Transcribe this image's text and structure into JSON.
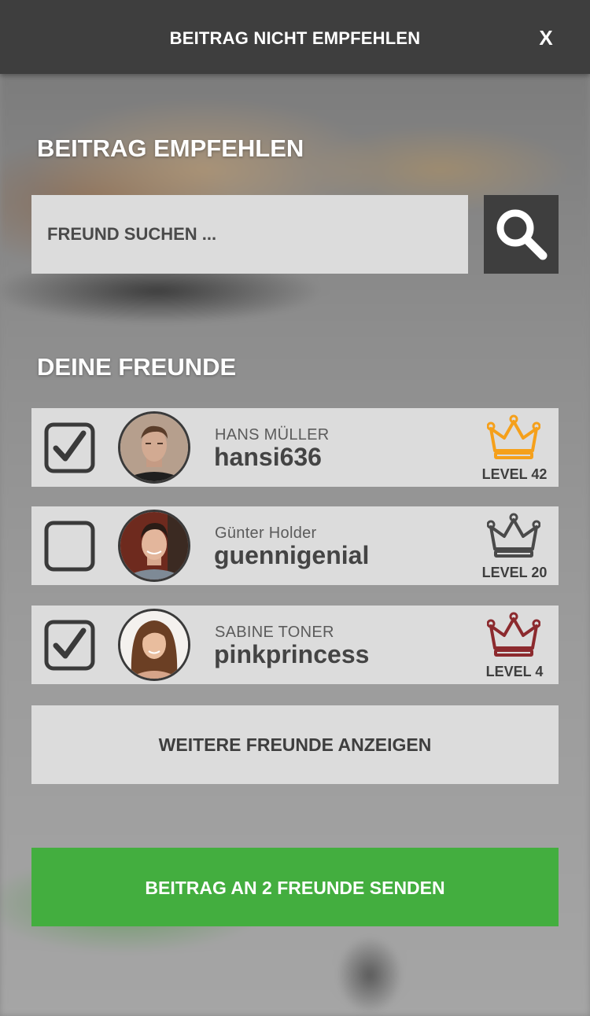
{
  "header": {
    "title": "BEITRAG NICHT EMPFEHLEN",
    "close_label": "X"
  },
  "recommend": {
    "title": "BEITRAG EMPFEHLEN",
    "search_placeholder": "FREUND SUCHEN ...",
    "search_icon": "search-icon"
  },
  "friends": {
    "title": "DEINE FREUNDE",
    "items": [
      {
        "name": "HANS MÜLLER",
        "username": "hansi636",
        "level": "LEVEL 42",
        "checked": true,
        "crown_color": "#f5a01b"
      },
      {
        "name": "Günter Holder",
        "username": "guennigenial",
        "level": "LEVEL 20",
        "checked": false,
        "crown_color": "#4a4a4a"
      },
      {
        "name": "SABINE TONER",
        "username": "pinkprincess",
        "level": "LEVEL 4",
        "checked": true,
        "crown_color": "#8c2a2e"
      }
    ],
    "more_label": "WEITERE FREUNDE ANZEIGEN"
  },
  "send": {
    "label": "BEITRAG AN 2 FREUNDE SENDEN",
    "color": "#43ae3f"
  }
}
